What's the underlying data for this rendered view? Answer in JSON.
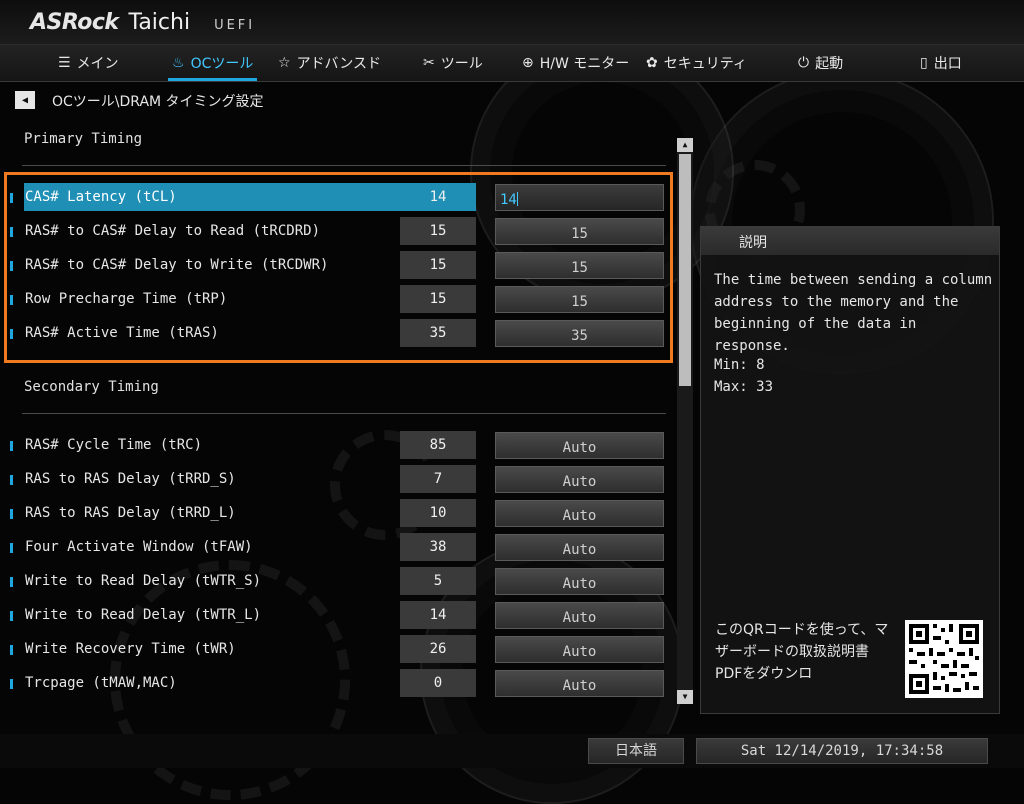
{
  "header": {
    "brand": "ASRock",
    "model": "Taichi",
    "uefi": "UEFI"
  },
  "nav": {
    "tabs": [
      {
        "label": "メイン",
        "icon": "menu-list-icon",
        "glyph": "☰"
      },
      {
        "label": "OCツール",
        "icon": "flame-icon",
        "glyph": "🔥"
      },
      {
        "label": "アドバンスド",
        "icon": "star-icon",
        "glyph": "☆"
      },
      {
        "label": "ツール",
        "icon": "tools-icon",
        "glyph": "✂"
      },
      {
        "label": "H/W モニター",
        "icon": "crosshair-icon",
        "glyph": "⊕"
      },
      {
        "label": "セキュリティ",
        "icon": "shield-icon",
        "glyph": "✿"
      },
      {
        "label": "起動",
        "icon": "power-icon",
        "glyph": "⏻"
      },
      {
        "label": "出口",
        "icon": "exit-door-icon",
        "glyph": "▯"
      }
    ],
    "active_index": 1
  },
  "breadcrumb": {
    "back_glyph": "◀",
    "path": "OCツール\\DRAM タイミング設定"
  },
  "primary": {
    "title": "Primary Timing",
    "rows": [
      {
        "label": "CAS# Latency (tCL)",
        "current": "14",
        "setting": "14"
      },
      {
        "label": "RAS# to CAS# Delay to Read  (tRCDRD)",
        "current": "15",
        "setting": "15"
      },
      {
        "label": "RAS# to CAS# Delay to Write (tRCDWR)",
        "current": "15",
        "setting": "15"
      },
      {
        "label": "Row Precharge Time (tRP)",
        "current": "15",
        "setting": "15"
      },
      {
        "label": "RAS# Active Time (tRAS)",
        "current": "35",
        "setting": "35"
      }
    ]
  },
  "secondary": {
    "title": "Secondary Timing",
    "rows": [
      {
        "label": "RAS# Cycle Time (tRC)",
        "current": "85",
        "setting": "Auto"
      },
      {
        "label": "RAS to RAS Delay (tRRD_S)",
        "current": "7",
        "setting": "Auto"
      },
      {
        "label": "RAS to RAS Delay (tRRD_L)",
        "current": "10",
        "setting": "Auto"
      },
      {
        "label": "Four Activate Window (tFAW)",
        "current": "38",
        "setting": "Auto"
      },
      {
        "label": "Write to Read Delay (tWTR_S)",
        "current": "5",
        "setting": "Auto"
      },
      {
        "label": "Write to Read Delay (tWTR_L)",
        "current": "14",
        "setting": "Auto"
      },
      {
        "label": "Write Recovery Time (tWR)",
        "current": "26",
        "setting": "Auto"
      },
      {
        "label": "Trcpage (tMAW,MAC)",
        "current": "0",
        "setting": "Auto"
      }
    ]
  },
  "scrollbar": {
    "up_glyph": "▲",
    "down_glyph": "▼"
  },
  "description": {
    "title": "説明",
    "text": "The time between sending a column address to the memory and the beginning of the data in response.",
    "min": "Min: 8",
    "max": "Max: 33",
    "qr_text": "このQRコードを使って、マザーボードの取扱説明書PDFをダウンロ"
  },
  "footer": {
    "language": "日本語",
    "datetime": "Sat 12/14/2019, 17:34:58"
  },
  "colors": {
    "accent": "#1fa7e0",
    "highlight_box": "#f07a20",
    "selected_row": "#1f8fb5"
  }
}
